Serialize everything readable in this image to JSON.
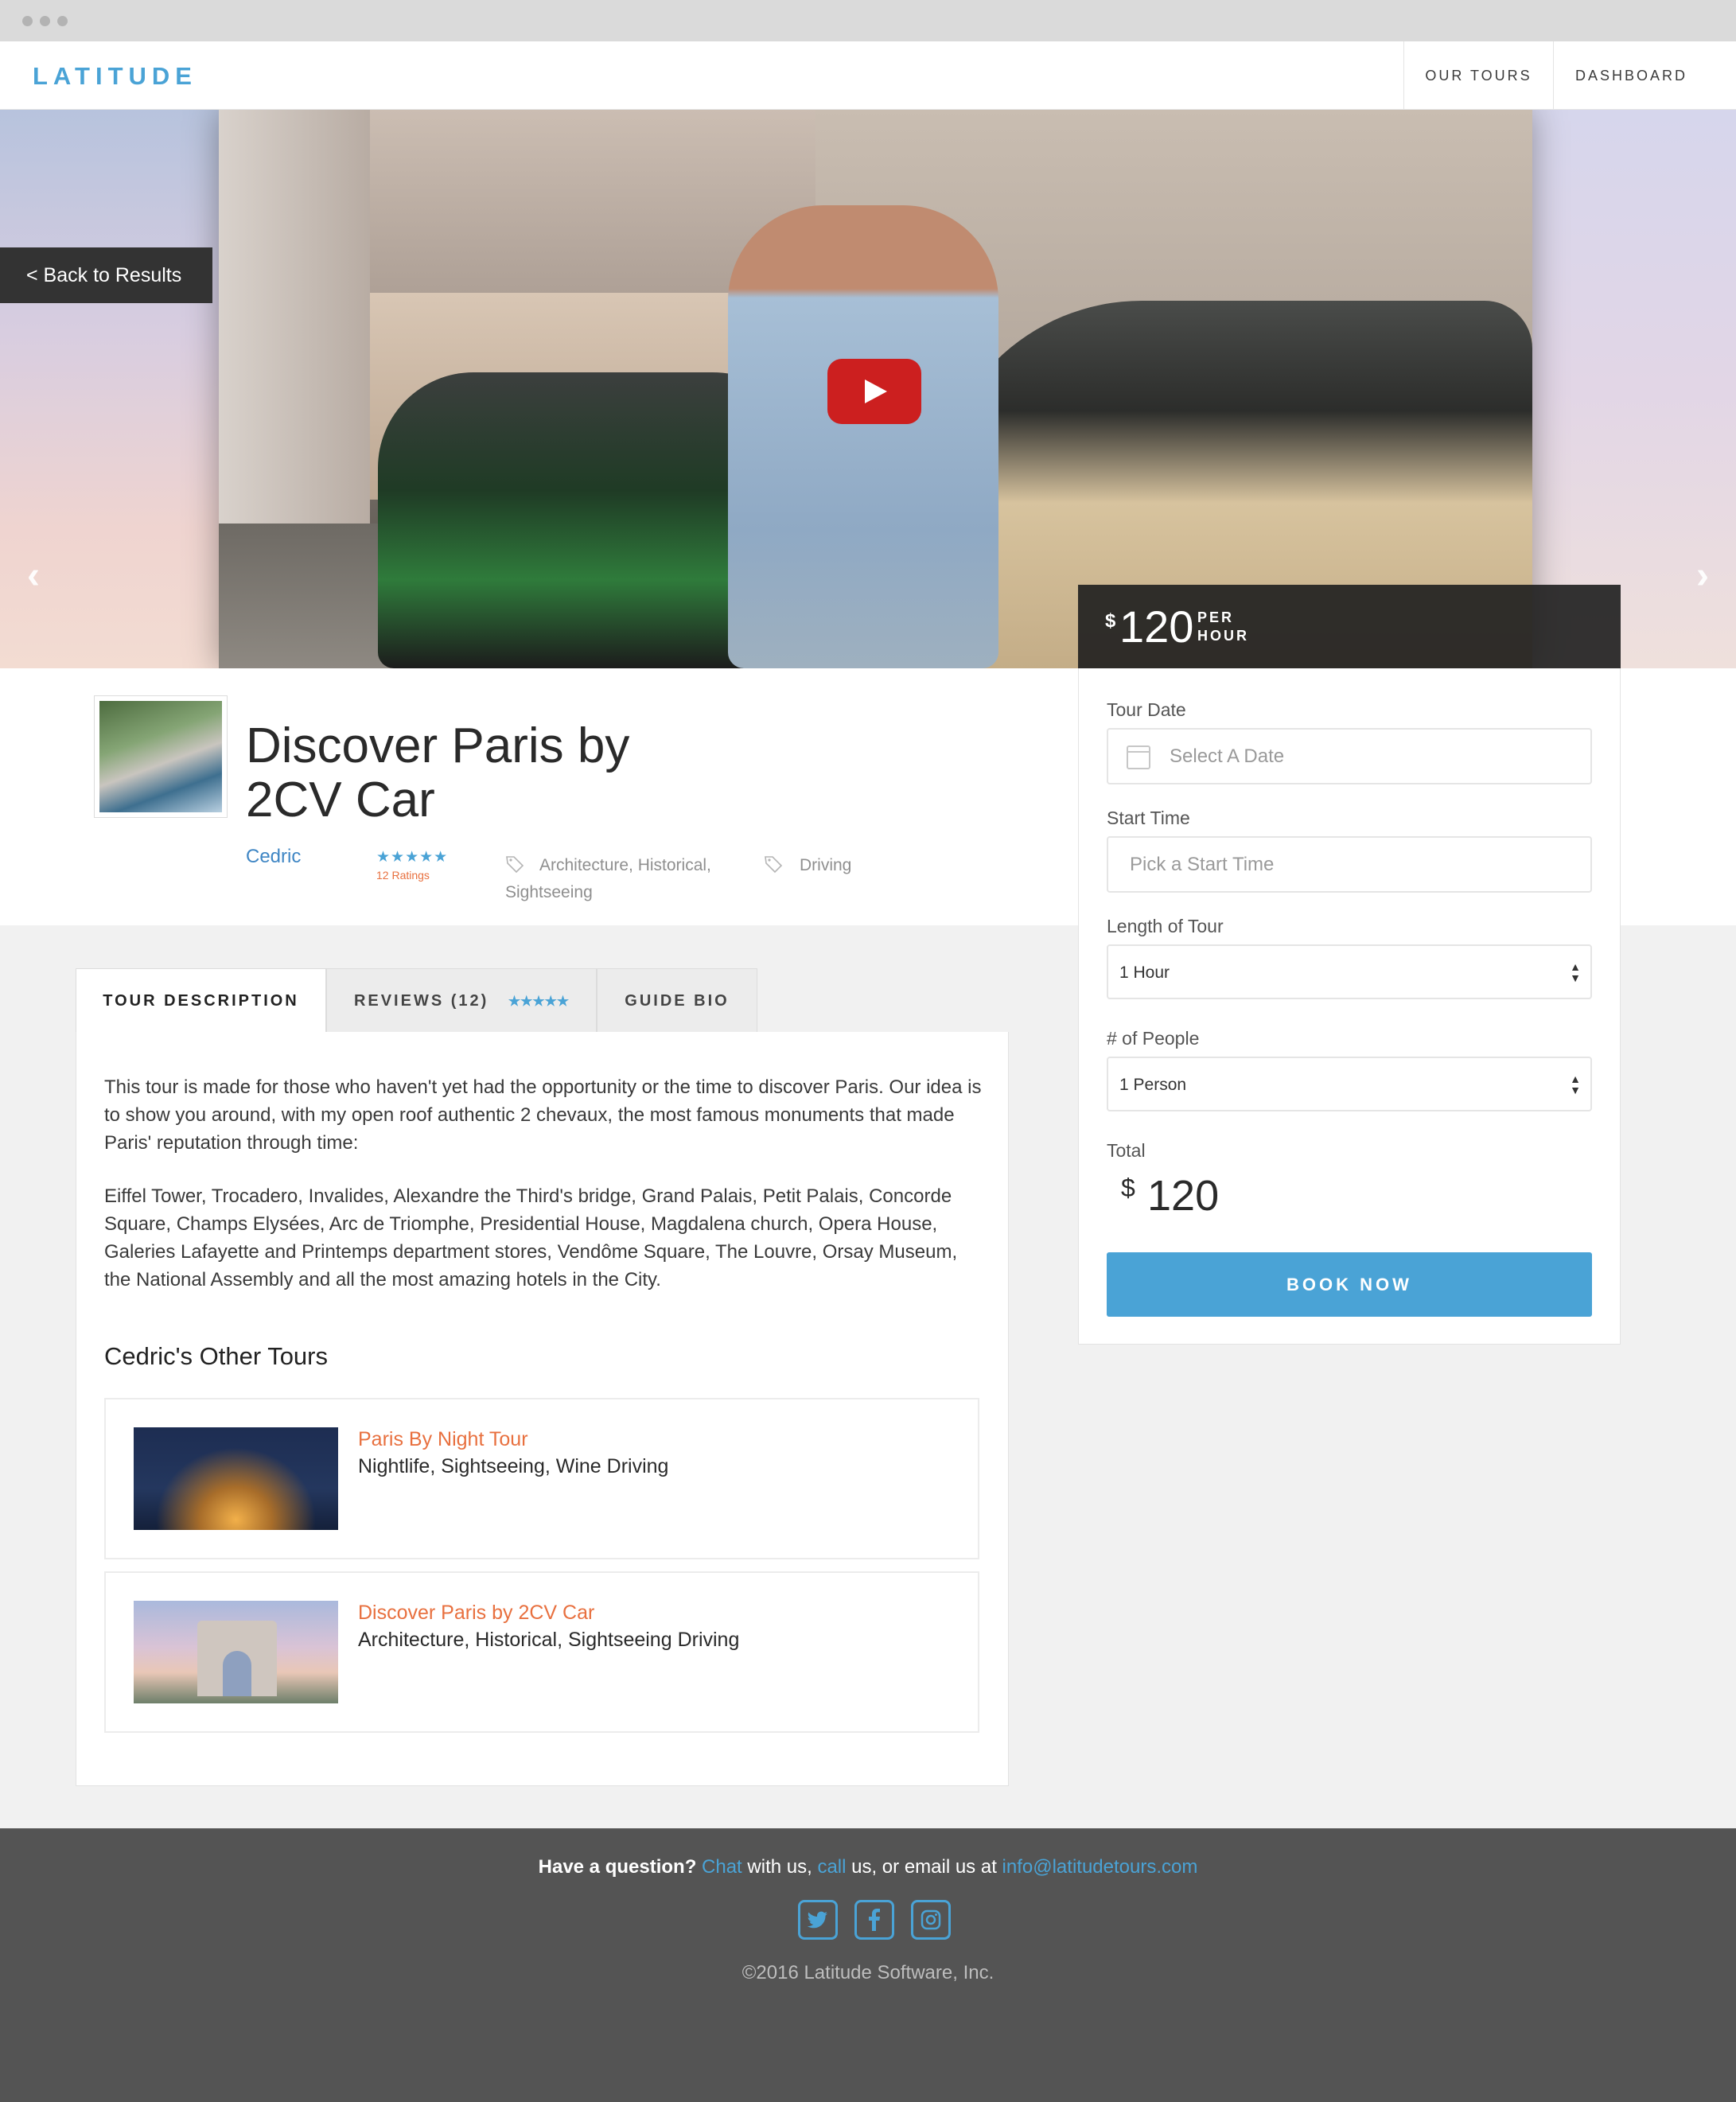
{
  "brand": {
    "logo": "LATITUDE",
    "accent_color": "#4aa3d6",
    "highlight_color": "#e8703f"
  },
  "nav": {
    "items": [
      {
        "label": "OUR TOURS"
      },
      {
        "label": "DASHBOARD"
      }
    ]
  },
  "hero": {
    "back_label": "< Back to Results",
    "prev_arrow": "‹",
    "next_arrow": "›",
    "play_icon": "youtube-play-icon"
  },
  "price": {
    "currency": "$",
    "amount": "120",
    "per_line1": "PER",
    "per_line2": "HOUR"
  },
  "tour": {
    "title": "Discover Paris by 2CV Car",
    "guide": "Cedric",
    "stars": "★★★★★",
    "rating_count": "12 Ratings",
    "tags": [
      "Architecture, Historical,",
      "Sightseeing",
      "Driving"
    ]
  },
  "booking": {
    "date_label": "Tour Date",
    "date_placeholder": "Select A Date",
    "time_label": "Start Time",
    "time_placeholder": "Pick a Start Time",
    "length_label": "Length of Tour",
    "length_value": "1 Hour",
    "people_label": "# of People",
    "people_value": "1 Person",
    "total_label": "Total",
    "total_currency": "$",
    "total_amount": "120",
    "book_label": "BOOK NOW"
  },
  "tabs": [
    {
      "label": "TOUR DESCRIPTION",
      "active": true
    },
    {
      "label": "REVIEWS (12)",
      "stars": "★★★★★"
    },
    {
      "label": "GUIDE BIO"
    }
  ],
  "description": {
    "paragraph1": "This tour is made for those who haven't yet had the opportunity or the time to discover Paris. Our idea is to show you around, with my open roof authentic 2 chevaux, the most famous monuments that made Paris' reputation through time:",
    "paragraph2": "Eiffel Tower, Trocadero, Invalides, Alexandre the Third's bridge, Grand Palais, Petit Palais, Concorde Square, Champs Elysées, Arc de Triomphe, Presidential House, Magdalena church, Opera House, Galeries Lafayette and Printemps department stores, Vendôme Square, The Louvre, Orsay Museum, the National Assembly and all the most amazing hotels in the City."
  },
  "other_tours": {
    "heading": "Cedric's Other Tours",
    "items": [
      {
        "title": "Paris By Night Tour",
        "subtitle": "Nightlife, Sightseeing, Wine Driving"
      },
      {
        "title": "Discover Paris by 2CV Car",
        "subtitle": "Architecture, Historical, Sightseeing Driving"
      }
    ]
  },
  "footer": {
    "question": "Have a question?",
    "chat": "Chat",
    "with_us": " with us, ",
    "call": "call",
    "or_email": " us, or email us at ",
    "email": "info@latitudetours.com",
    "social": [
      "twitter-icon",
      "facebook-icon",
      "instagram-icon"
    ],
    "copyright": "©2016 Latitude Software, Inc."
  }
}
